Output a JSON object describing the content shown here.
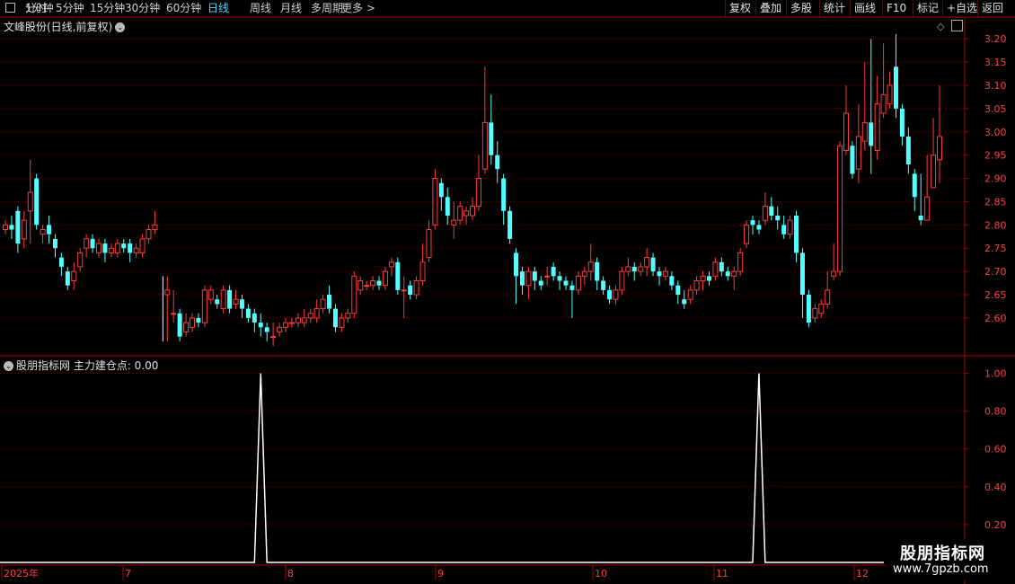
{
  "toolbar": {
    "left_items": [
      "分时",
      "1分钟",
      "5分钟",
      "15分钟",
      "30分钟",
      "60分钟",
      "日线",
      "周线",
      "月线",
      "多周期",
      "更多 >"
    ],
    "active": "日线",
    "right_items": [
      "复权",
      "叠加",
      "多股",
      "统计",
      "画线",
      "F10",
      "标记",
      "+自选",
      "返回"
    ]
  },
  "main": {
    "title": "文峰股份(日线,前复权)",
    "y_ticks": [
      "3.20",
      "3.15",
      "3.10",
      "3.05",
      "3.00",
      "2.95",
      "2.90",
      "2.85",
      "2.80",
      "2.75",
      "2.70",
      "2.65",
      "2.60"
    ]
  },
  "indicator": {
    "title": "股朋指标网  主力建仓点: 0.00",
    "y_ticks": [
      "1.00",
      "0.80",
      "0.60",
      "0.40",
      "0.20"
    ]
  },
  "xaxis": {
    "labels": [
      "2025年",
      "7",
      "8",
      "9",
      "10",
      "11",
      "12"
    ]
  },
  "watermark": {
    "line1": "股朋指标网",
    "line2": "www.7gpzb.com"
  },
  "colors": {
    "up": "#ff3b3b",
    "down": "#54ffff",
    "grid": "#7a0000",
    "line": "#ffffff"
  },
  "chart_data": {
    "type": "candlestick",
    "candles": [
      [
        2.79,
        2.8,
        2.78,
        2.81
      ],
      [
        2.8,
        2.79,
        2.77,
        2.82
      ],
      [
        2.83,
        2.76,
        2.74,
        2.84
      ],
      [
        2.77,
        2.81,
        2.75,
        2.83
      ],
      [
        2.83,
        2.87,
        2.76,
        2.94
      ],
      [
        2.9,
        2.8,
        2.79,
        2.91
      ],
      [
        2.78,
        2.79,
        2.76,
        2.8
      ],
      [
        2.8,
        2.78,
        2.76,
        2.82
      ],
      [
        2.77,
        2.75,
        2.73,
        2.78
      ],
      [
        2.73,
        2.71,
        2.69,
        2.74
      ],
      [
        2.7,
        2.67,
        2.66,
        2.71
      ],
      [
        2.68,
        2.7,
        2.66,
        2.72
      ],
      [
        2.71,
        2.74,
        2.7,
        2.75
      ],
      [
        2.75,
        2.77,
        2.73,
        2.78
      ],
      [
        2.77,
        2.75,
        2.74,
        2.78
      ],
      [
        2.74,
        2.76,
        2.73,
        2.77
      ],
      [
        2.76,
        2.74,
        2.72,
        2.77
      ],
      [
        2.74,
        2.75,
        2.73,
        2.76
      ],
      [
        2.74,
        2.76,
        2.73,
        2.77
      ],
      [
        2.76,
        2.75,
        2.74,
        2.77
      ],
      [
        2.76,
        2.74,
        2.72,
        2.77
      ],
      [
        2.74,
        2.75,
        2.73,
        2.76
      ],
      [
        2.74,
        2.77,
        2.73,
        2.78
      ],
      [
        2.77,
        2.79,
        2.76,
        2.8
      ],
      [
        2.79,
        2.8,
        2.78,
        2.83
      ],
      null,
      [
        2.65,
        2.66,
        2.55,
        2.69
      ],
      [
        2.61,
        2.61,
        2.59,
        2.66
      ],
      [
        2.61,
        2.56,
        2.55,
        2.62
      ],
      [
        2.57,
        2.59,
        2.56,
        2.61
      ],
      [
        2.58,
        2.6,
        2.57,
        2.61
      ],
      [
        2.6,
        2.59,
        2.58,
        2.61
      ],
      [
        2.59,
        2.66,
        2.58,
        2.67
      ],
      [
        2.64,
        2.66,
        2.63,
        2.67
      ],
      [
        2.64,
        2.63,
        2.62,
        2.65
      ],
      [
        2.62,
        2.66,
        2.61,
        2.67
      ],
      [
        2.66,
        2.62,
        2.61,
        2.67
      ],
      [
        2.63,
        2.64,
        2.62,
        2.66
      ],
      [
        2.64,
        2.62,
        2.6,
        2.65
      ],
      [
        2.62,
        2.6,
        2.59,
        2.63
      ],
      [
        2.61,
        2.59,
        2.57,
        2.62
      ],
      [
        2.59,
        2.58,
        2.56,
        2.61
      ],
      [
        2.58,
        2.57,
        2.55,
        2.59
      ],
      [
        2.56,
        2.56,
        2.54,
        2.59
      ],
      [
        2.57,
        2.58,
        2.56,
        2.59
      ],
      [
        2.58,
        2.59,
        2.57,
        2.6
      ],
      [
        2.59,
        2.59,
        2.58,
        2.6
      ],
      [
        2.59,
        2.6,
        2.58,
        2.61
      ],
      [
        2.59,
        2.6,
        2.58,
        2.62
      ],
      [
        2.6,
        2.61,
        2.59,
        2.62
      ],
      [
        2.6,
        2.62,
        2.59,
        2.64
      ],
      [
        2.62,
        2.64,
        2.61,
        2.65
      ],
      [
        2.65,
        2.62,
        2.61,
        2.67
      ],
      [
        2.62,
        2.58,
        2.57,
        2.63
      ],
      [
        2.58,
        2.6,
        2.57,
        2.61
      ],
      [
        2.6,
        2.61,
        2.59,
        2.62
      ],
      [
        2.61,
        2.69,
        2.6,
        2.7
      ],
      [
        2.66,
        2.68,
        2.65,
        2.69
      ],
      [
        2.67,
        2.67,
        2.66,
        2.68
      ],
      [
        2.67,
        2.68,
        2.66,
        2.69
      ],
      [
        2.68,
        2.67,
        2.66,
        2.69
      ],
      [
        2.67,
        2.7,
        2.66,
        2.71
      ],
      [
        2.71,
        2.72,
        2.69,
        2.73
      ],
      [
        2.72,
        2.66,
        2.65,
        2.73
      ],
      [
        2.66,
        2.66,
        2.6,
        2.69
      ],
      [
        2.67,
        2.65,
        2.64,
        2.68
      ],
      [
        2.65,
        2.68,
        2.64,
        2.69
      ],
      [
        2.68,
        2.72,
        2.67,
        2.76
      ],
      [
        2.73,
        2.79,
        2.72,
        2.81
      ],
      [
        2.8,
        2.9,
        2.79,
        2.92
      ],
      [
        2.89,
        2.86,
        2.83,
        2.9
      ],
      [
        2.86,
        2.82,
        2.8,
        2.88
      ],
      [
        2.8,
        2.81,
        2.77,
        2.85
      ],
      [
        2.81,
        2.84,
        2.8,
        2.85
      ],
      [
        2.82,
        2.83,
        2.8,
        2.84
      ],
      [
        2.82,
        2.84,
        2.81,
        2.86
      ],
      [
        2.84,
        2.9,
        2.83,
        2.95
      ],
      [
        2.92,
        3.02,
        2.91,
        3.14
      ],
      [
        3.02,
        2.95,
        2.93,
        3.08
      ],
      [
        2.95,
        2.92,
        2.89,
        2.98
      ],
      [
        2.9,
        2.83,
        2.8,
        2.91
      ],
      [
        2.83,
        2.77,
        2.76,
        2.84
      ],
      [
        2.74,
        2.69,
        2.63,
        2.75
      ],
      [
        2.7,
        2.67,
        2.65,
        2.71
      ],
      [
        2.67,
        2.7,
        2.64,
        2.71
      ],
      [
        2.7,
        2.68,
        2.66,
        2.71
      ],
      [
        2.68,
        2.67,
        2.66,
        2.69
      ],
      [
        2.69,
        2.69,
        2.67,
        2.71
      ],
      [
        2.71,
        2.69,
        2.68,
        2.72
      ],
      [
        2.69,
        2.68,
        2.66,
        2.7
      ],
      [
        2.68,
        2.67,
        2.66,
        2.69
      ],
      [
        2.67,
        2.66,
        2.6,
        2.68
      ],
      [
        2.66,
        2.69,
        2.65,
        2.7
      ],
      [
        2.69,
        2.7,
        2.67,
        2.71
      ],
      [
        2.7,
        2.72,
        2.68,
        2.76
      ],
      [
        2.72,
        2.68,
        2.66,
        2.73
      ],
      [
        2.68,
        2.66,
        2.65,
        2.69
      ],
      [
        2.66,
        2.64,
        2.63,
        2.67
      ],
      [
        2.64,
        2.66,
        2.63,
        2.67
      ],
      [
        2.66,
        2.7,
        2.65,
        2.71
      ],
      [
        2.7,
        2.71,
        2.69,
        2.73
      ],
      [
        2.71,
        2.7,
        2.68,
        2.72
      ],
      [
        2.7,
        2.71,
        2.69,
        2.72
      ],
      [
        2.71,
        2.73,
        2.69,
        2.75
      ],
      [
        2.73,
        2.7,
        2.69,
        2.74
      ],
      [
        2.7,
        2.69,
        2.67,
        2.71
      ],
      [
        2.69,
        2.7,
        2.68,
        2.71
      ],
      [
        2.69,
        2.67,
        2.66,
        2.7
      ],
      [
        2.67,
        2.65,
        2.63,
        2.68
      ],
      [
        2.64,
        2.63,
        2.62,
        2.66
      ],
      [
        2.64,
        2.66,
        2.63,
        2.67
      ],
      [
        2.66,
        2.68,
        2.65,
        2.69
      ],
      [
        2.68,
        2.69,
        2.66,
        2.7
      ],
      [
        2.69,
        2.68,
        2.67,
        2.7
      ],
      [
        2.69,
        2.72,
        2.68,
        2.73
      ],
      [
        2.72,
        2.7,
        2.69,
        2.73
      ],
      [
        2.7,
        2.69,
        2.68,
        2.71
      ],
      [
        2.69,
        2.7,
        2.66,
        2.71
      ],
      [
        2.7,
        2.74,
        2.69,
        2.75
      ],
      [
        2.76,
        2.8,
        2.75,
        2.81
      ],
      [
        2.81,
        2.8,
        2.78,
        2.82
      ],
      [
        2.8,
        2.79,
        2.78,
        2.81
      ],
      [
        2.81,
        2.84,
        2.8,
        2.87
      ],
      [
        2.84,
        2.82,
        2.81,
        2.86
      ],
      [
        2.82,
        2.81,
        2.79,
        2.84
      ],
      [
        2.8,
        2.78,
        2.77,
        2.82
      ],
      [
        2.78,
        2.81,
        2.77,
        2.82
      ],
      [
        2.82,
        2.74,
        2.72,
        2.83
      ],
      [
        2.74,
        2.65,
        2.6,
        2.75
      ],
      [
        2.65,
        2.59,
        2.58,
        2.66
      ],
      [
        2.6,
        2.62,
        2.59,
        2.63
      ],
      [
        2.61,
        2.63,
        2.6,
        2.64
      ],
      [
        2.63,
        2.66,
        2.62,
        2.7
      ],
      [
        2.69,
        2.7,
        2.68,
        2.76
      ],
      [
        2.7,
        2.97,
        2.69,
        2.98
      ],
      [
        2.96,
        3.04,
        2.95,
        3.1
      ],
      [
        2.97,
        2.91,
        2.9,
        2.98
      ],
      [
        2.92,
        2.99,
        2.89,
        3.06
      ],
      [
        2.98,
        3.02,
        2.96,
        3.15
      ],
      [
        3.02,
        2.97,
        2.91,
        3.2
      ],
      [
        2.96,
        3.06,
        2.94,
        3.12
      ],
      [
        3.04,
        3.08,
        3.03,
        3.19
      ],
      [
        3.06,
        3.1,
        3.05,
        3.13
      ],
      [
        3.14,
        3.05,
        3.03,
        3.21
      ],
      [
        3.05,
        2.99,
        2.97,
        3.06
      ],
      [
        2.99,
        2.93,
        2.91,
        3.01
      ],
      [
        2.91,
        2.86,
        2.83,
        2.92
      ],
      [
        2.82,
        2.81,
        2.8,
        2.91
      ],
      [
        2.81,
        2.86,
        2.81,
        2.95
      ],
      [
        2.88,
        2.95,
        2.88,
        3.03
      ],
      [
        2.94,
        2.99,
        2.89,
        3.1
      ]
    ],
    "indicator": {
      "name": "主力建仓点",
      "spikes_at_index": [
        41,
        121
      ]
    },
    "ylim": [
      2.54,
      3.21
    ],
    "indicator_ylim": [
      0,
      1.05
    ]
  }
}
